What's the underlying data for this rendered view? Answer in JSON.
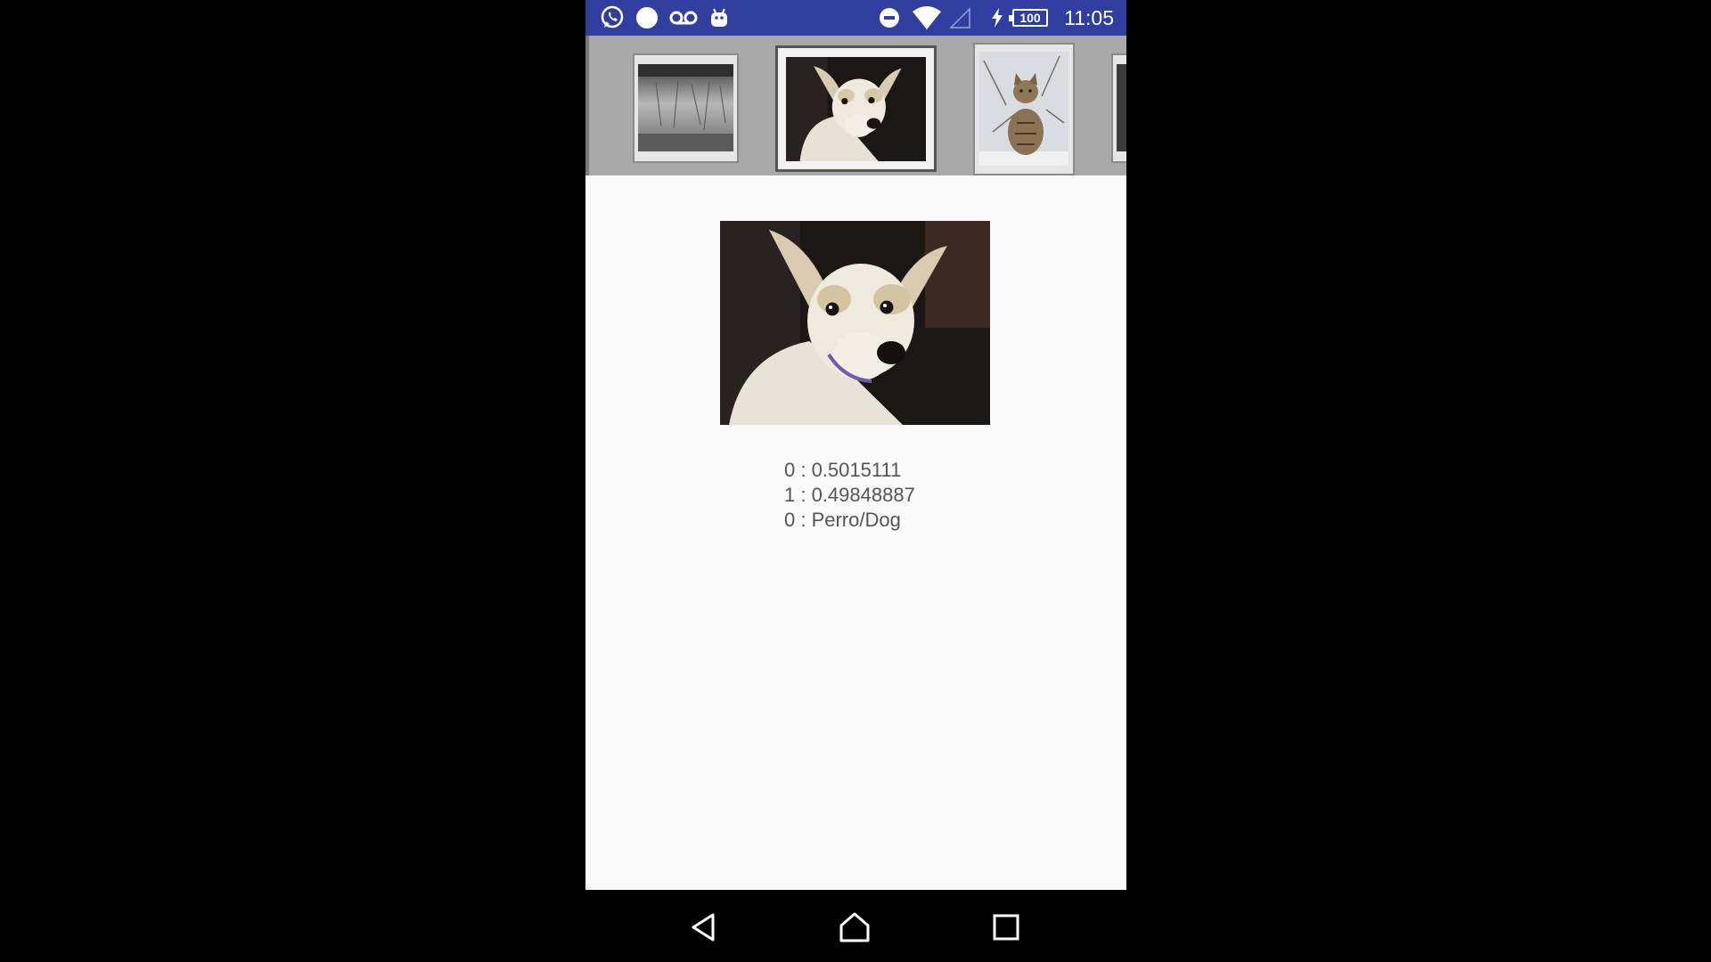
{
  "status_bar": {
    "time": "11:05",
    "battery_level": "100",
    "left_icons": [
      "whatsapp-icon",
      "circle-notification-icon",
      "voicemail-icon",
      "android-icon"
    ],
    "right_icons": [
      "do-not-disturb-icon",
      "wifi-icon",
      "no-signal-icon",
      "charging-icon",
      "battery-icon"
    ],
    "background_color": "#303f9f"
  },
  "gallery": {
    "items": [
      {
        "name": "texture-thumbnail",
        "selected": false
      },
      {
        "name": "dog-thumbnail",
        "selected": true
      },
      {
        "name": "cat-thumbnail",
        "selected": false
      },
      {
        "name": "partial-thumbnail",
        "selected": false
      }
    ]
  },
  "main": {
    "photo": "dog-photo",
    "results": [
      "0 : 0.5015111",
      "1 : 0.49848887",
      "0 : Perro/Dog"
    ]
  },
  "nav_bar": {
    "buttons": [
      "back-icon",
      "home-icon",
      "recents-icon"
    ]
  }
}
